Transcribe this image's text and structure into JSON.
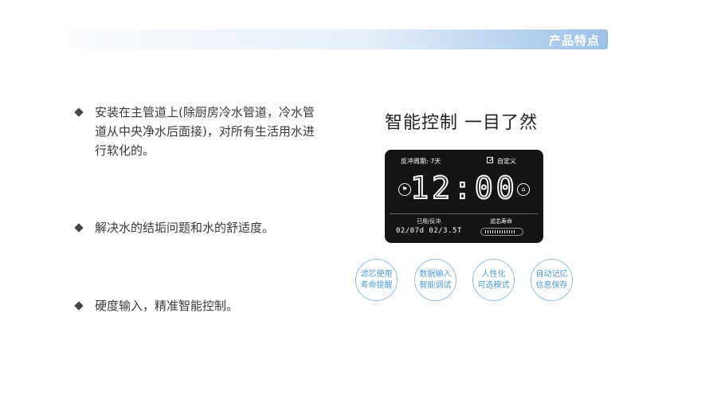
{
  "header": {
    "title": "产品特点"
  },
  "features": [
    {
      "text": "安装在主管道上(除厨房冷水管道，冷水管道从中央净水后面接)，对所有生活用水进行软化的。"
    },
    {
      "text": "解决水的结垢问题和水的舒适度。"
    },
    {
      "text": "硬度输入，精准智能控制。"
    }
  ],
  "panel": {
    "title": "智能控制  一目了然",
    "display": {
      "cycle_label": "反冲周期: 7天",
      "custom_label": "自定义",
      "time": "12:00",
      "used_label": "已用/反冲",
      "filter_label": "滤芯寿命",
      "used_value": "02/07d  02/3.5T",
      "filter_life_fraction": 0.85,
      "left_icon": "running-person-icon",
      "right_icon": "home-icon",
      "custom_icon": "edit-icon"
    },
    "badges": [
      {
        "line1": "滤芯使用",
        "line2": "寿命提醒"
      },
      {
        "line1": "数据输入",
        "line2": "智能调试"
      },
      {
        "line1": "人性化",
        "line2": "可选模式"
      },
      {
        "line1": "自动记忆",
        "line2": "信息保存"
      }
    ]
  },
  "colors": {
    "accent": "#4d9ad6",
    "header_gradient_end": "#9cc1e8",
    "display_bg": "#141414"
  }
}
